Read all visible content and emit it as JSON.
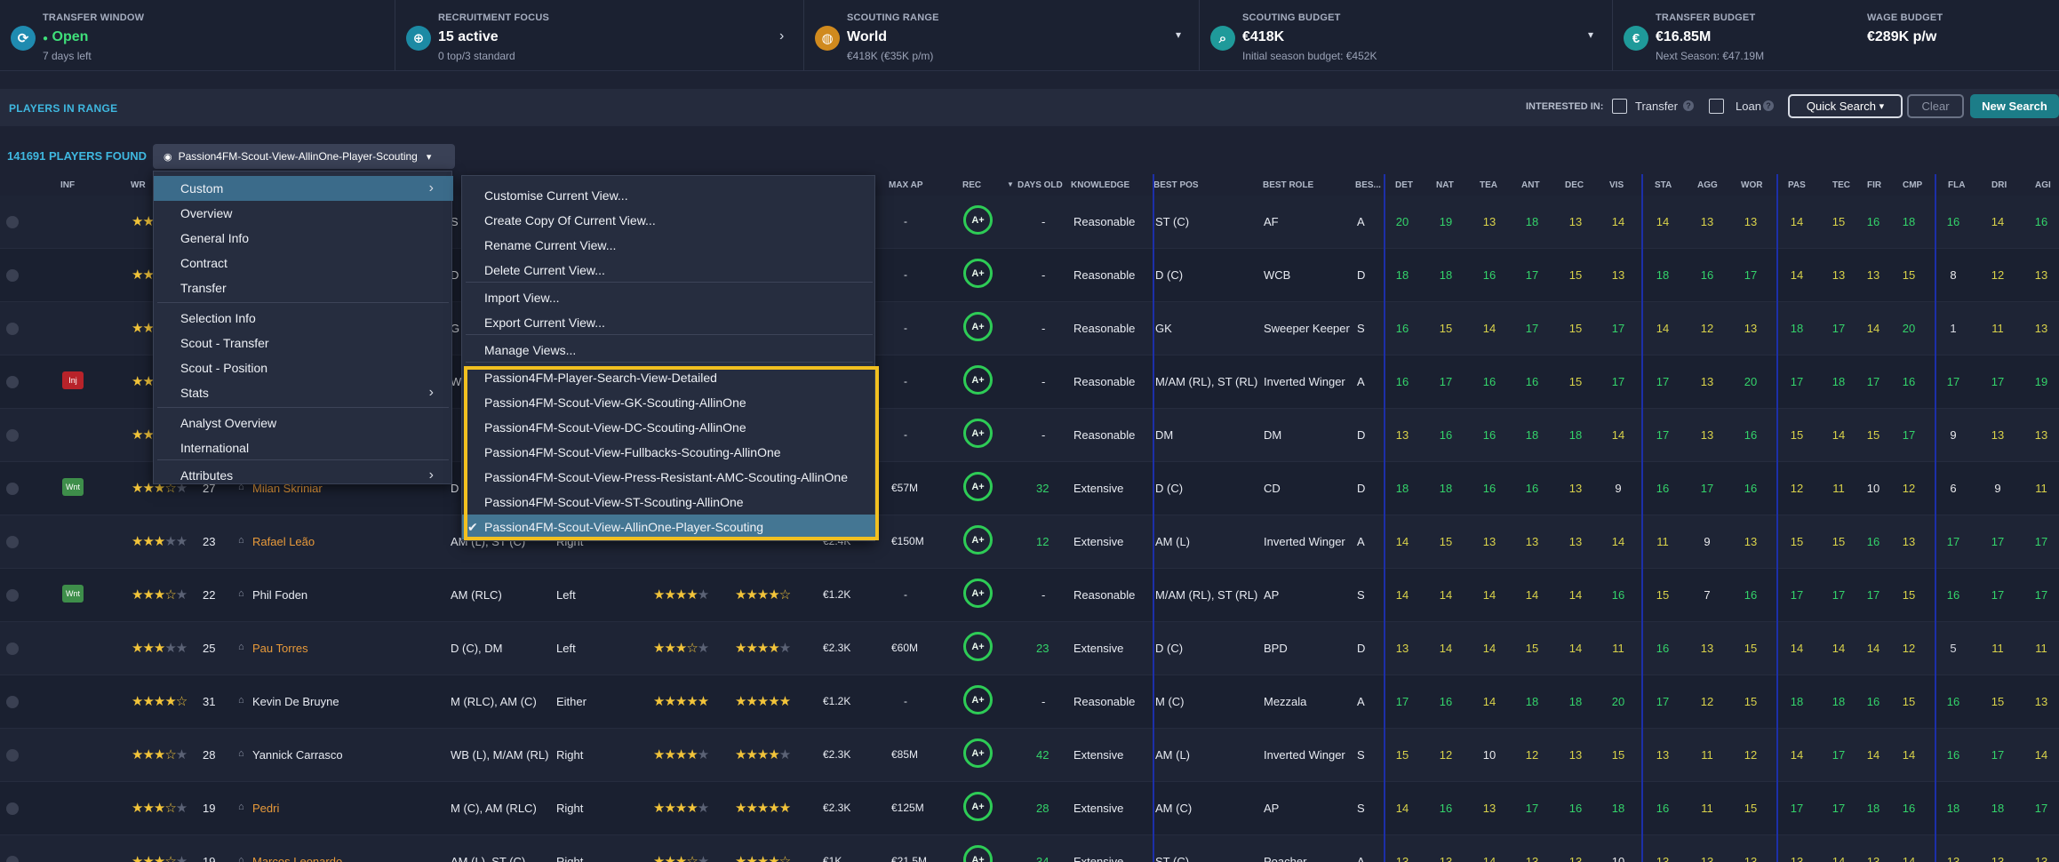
{
  "top": {
    "transfer_window": {
      "label": "TRANSFER WINDOW",
      "value": "Open",
      "sub": "7 days left",
      "icon": "refresh-icon"
    },
    "recruitment": {
      "label": "RECRUITMENT FOCUS",
      "value": "15 active",
      "sub": "0 top/3 standard",
      "icon": "target-icon"
    },
    "scouting_range": {
      "label": "SCOUTING RANGE",
      "value": "World",
      "sub": "€418K (€35K p/m)",
      "icon": "globe-icon"
    },
    "scouting_budget": {
      "label": "SCOUTING BUDGET",
      "value": "€418K",
      "sub": "Initial season budget: €452K",
      "icon": "search-icon"
    },
    "transfer_budget": {
      "label": "TRANSFER BUDGET",
      "value": "€16.85M",
      "sub": "Next Season: €47.19M",
      "icon": "money-icon"
    },
    "wage_budget": {
      "label": "WAGE BUDGET",
      "value": "€289K p/w"
    }
  },
  "bar": {
    "title": "PLAYERS IN RANGE",
    "interested_in": "INTERESTED IN:",
    "transfer": "Transfer",
    "loan": "Loan",
    "quick_search": "Quick Search",
    "clear": "Clear",
    "new_search": "New Search",
    "found": "141691 PLAYERS FOUND",
    "view_name": "Passion4FM-Scout-View-AllinOne-Player-Scouting"
  },
  "headers": {
    "inf": "INF",
    "wr": "WR",
    "max_ap": "MAX AP",
    "rec": "REC",
    "days_old": "DAYS OLD",
    "knowledge": "KNOWLEDGE",
    "best_pos": "BEST POS",
    "best_role": "BEST ROLE",
    "bes": "BES...",
    "det": "DET",
    "nat": "NAT",
    "tea": "TEA",
    "ant": "ANT",
    "dec": "DEC",
    "vis": "VIS",
    "sta": "STA",
    "agg": "AGG",
    "wor": "WOR",
    "pas": "PAS",
    "tec": "TEC",
    "fir": "FIR",
    "cmp": "CMP",
    "fla": "FLA",
    "dri": "DRI",
    "agi": "AGI"
  },
  "rows": [
    {
      "tag": "",
      "stars": 4,
      "age": "",
      "name": "",
      "pos": "S",
      "foot": "",
      "ca": 0,
      "pa": 0,
      "wage": "",
      "ap": "-",
      "rec": "A+",
      "days": "-",
      "know": "Reasonable",
      "bpos": "ST (C)",
      "brole": "AF",
      "duty": "A",
      "a": [
        "20",
        "19",
        "13",
        "18",
        "13",
        "14",
        "14",
        "13",
        "13",
        "14",
        "15",
        "16",
        "18",
        "16",
        "14",
        "16"
      ]
    },
    {
      "tag": "",
      "stars": 4,
      "age": "",
      "name": "",
      "pos": "D",
      "foot": "",
      "ca": 0,
      "pa": 0,
      "wage": "",
      "ap": "-",
      "rec": "A+",
      "days": "-",
      "know": "Reasonable",
      "bpos": "D (C)",
      "brole": "WCB",
      "duty": "D",
      "a": [
        "18",
        "18",
        "16",
        "17",
        "15",
        "13",
        "18",
        "16",
        "17",
        "14",
        "13",
        "13",
        "15",
        "8",
        "12",
        "13"
      ]
    },
    {
      "tag": "",
      "stars": 4,
      "age": "",
      "name": "",
      "pos": "G",
      "foot": "",
      "ca": 0,
      "pa": 0,
      "wage": "",
      "ap": "-",
      "rec": "A+",
      "days": "-",
      "know": "Reasonable",
      "bpos": "GK",
      "brole": "Sweeper Keeper",
      "duty": "S",
      "a": [
        "16",
        "15",
        "14",
        "17",
        "15",
        "17",
        "14",
        "12",
        "13",
        "18",
        "17",
        "14",
        "20",
        "1",
        "11",
        "13"
      ]
    },
    {
      "tag": "Inj",
      "stars": 4,
      "age": "",
      "name": "",
      "pos": "W",
      "foot": "",
      "ca": 0,
      "pa": 0,
      "wage": "",
      "ap": "-",
      "rec": "A+",
      "days": "-",
      "know": "Reasonable",
      "bpos": "M/AM (RL), ST (RL)",
      "brole": "Inverted Winger",
      "duty": "A",
      "a": [
        "16",
        "17",
        "16",
        "16",
        "15",
        "17",
        "17",
        "13",
        "20",
        "17",
        "18",
        "17",
        "16",
        "17",
        "17",
        "19"
      ]
    },
    {
      "tag": "",
      "stars": 4,
      "age": "",
      "name": "",
      "pos": "",
      "foot": "",
      "ca": 0,
      "pa": 0,
      "wage": "",
      "ap": "-",
      "rec": "A+",
      "days": "-",
      "know": "Reasonable",
      "bpos": "DM",
      "brole": "DM",
      "duty": "D",
      "a": [
        "13",
        "16",
        "16",
        "18",
        "18",
        "14",
        "17",
        "13",
        "16",
        "15",
        "14",
        "15",
        "17",
        "9",
        "13",
        "13"
      ]
    },
    {
      "tag": "Wnt",
      "stars": 3.5,
      "age": "27",
      "name": "Milan Škriniar",
      "pos": "D",
      "foot": "",
      "ca": 0,
      "pa": 0,
      "wage": "",
      "ap": "€57M",
      "rec": "A+",
      "days": "32",
      "know": "Extensive",
      "bpos": "D (C)",
      "brole": "CD",
      "duty": "D",
      "a": [
        "18",
        "18",
        "16",
        "16",
        "13",
        "9",
        "16",
        "17",
        "16",
        "12",
        "11",
        "10",
        "12",
        "6",
        "9",
        "11"
      ]
    },
    {
      "tag": "",
      "stars": 3,
      "age": "23",
      "name": "Rafael Leão",
      "pos": "AM (L), ST (C)",
      "foot": "Right",
      "ca": 0,
      "pa": 0,
      "wage": "€2.4K",
      "ap": "€150M",
      "rec": "A+",
      "days": "12",
      "know": "Extensive",
      "bpos": "AM (L)",
      "brole": "Inverted Winger",
      "duty": "A",
      "a": [
        "14",
        "15",
        "13",
        "13",
        "13",
        "14",
        "11",
        "9",
        "13",
        "15",
        "15",
        "16",
        "13",
        "17",
        "17",
        "17"
      ]
    },
    {
      "tag": "Wnt",
      "stars": 3.5,
      "age": "22",
      "name": "Phil Foden",
      "pos": "AM (RLC)",
      "foot": "Left",
      "ca": 4,
      "pa": 4.5,
      "wage": "€1.2K",
      "ap": "-",
      "rec": "A+",
      "days": "-",
      "know": "Reasonable",
      "bpos": "M/AM (RL), ST (RL)",
      "brole": "AP",
      "duty": "S",
      "a": [
        "14",
        "14",
        "14",
        "14",
        "14",
        "16",
        "15",
        "7",
        "16",
        "17",
        "17",
        "17",
        "15",
        "16",
        "17",
        "17"
      ]
    },
    {
      "tag": "",
      "stars": 3,
      "age": "25",
      "name": "Pau Torres",
      "pos": "D (C), DM",
      "foot": "Left",
      "ca": 3.5,
      "pa": 4,
      "wage": "€2.3K",
      "ap": "€60M",
      "rec": "A+",
      "days": "23",
      "know": "Extensive",
      "bpos": "D (C)",
      "brole": "BPD",
      "duty": "D",
      "a": [
        "13",
        "14",
        "14",
        "15",
        "14",
        "11",
        "16",
        "13",
        "15",
        "14",
        "14",
        "14",
        "12",
        "5",
        "11",
        "11"
      ]
    },
    {
      "tag": "",
      "stars": 4.5,
      "age": "31",
      "name": "Kevin De Bruyne",
      "pos": "M (RLC), AM (C)",
      "foot": "Either",
      "ca": 5,
      "pa": 5,
      "wage": "€1.2K",
      "ap": "-",
      "rec": "A+",
      "days": "-",
      "know": "Reasonable",
      "bpos": "M (C)",
      "brole": "Mezzala",
      "duty": "A",
      "a": [
        "17",
        "16",
        "14",
        "18",
        "18",
        "20",
        "17",
        "12",
        "15",
        "18",
        "18",
        "16",
        "15",
        "16",
        "15",
        "13"
      ]
    },
    {
      "tag": "",
      "stars": 3.5,
      "age": "28",
      "name": "Yannick Carrasco",
      "pos": "WB (L), M/AM (RL)",
      "foot": "Right",
      "ca": 4,
      "pa": 4,
      "wage": "€2.3K",
      "ap": "€85M",
      "rec": "A+",
      "days": "42",
      "know": "Extensive",
      "bpos": "AM (L)",
      "brole": "Inverted Winger",
      "duty": "S",
      "a": [
        "15",
        "12",
        "10",
        "12",
        "13",
        "15",
        "13",
        "11",
        "12",
        "14",
        "17",
        "14",
        "14",
        "16",
        "17",
        "14"
      ]
    },
    {
      "tag": "",
      "stars": 3.5,
      "age": "19",
      "name": "Pedri",
      "pos": "M (C), AM (RLC)",
      "foot": "Right",
      "ca": 4,
      "pa": 5,
      "wage": "€2.3K",
      "ap": "€125M",
      "rec": "A+",
      "days": "28",
      "know": "Extensive",
      "bpos": "AM (C)",
      "brole": "AP",
      "duty": "S",
      "a": [
        "14",
        "16",
        "13",
        "17",
        "16",
        "18",
        "16",
        "11",
        "15",
        "17",
        "17",
        "18",
        "16",
        "18",
        "18",
        "17"
      ]
    },
    {
      "tag": "",
      "stars": 3.5,
      "age": "19",
      "name": "Marcos Leonardo",
      "pos": "AM (L), ST (C)",
      "foot": "Right",
      "ca": 3.5,
      "pa": 4.5,
      "wage": "€1K",
      "ap": "€21.5M",
      "rec": "A+",
      "days": "34",
      "know": "Extensive",
      "bpos": "ST (C)",
      "brole": "Poacher",
      "duty": "A",
      "a": [
        "13",
        "13",
        "14",
        "13",
        "13",
        "10",
        "13",
        "13",
        "13",
        "13",
        "14",
        "13",
        "14",
        "13",
        "13",
        "13"
      ]
    }
  ],
  "menu_left": {
    "items": [
      "Custom",
      "Overview",
      "General Info",
      "Contract",
      "Transfer",
      "Selection Info",
      "Scout - Transfer",
      "Scout - Position",
      "Stats",
      "Analyst Overview",
      "International",
      "Attributes"
    ]
  },
  "menu_right": {
    "items": [
      "Customise Current View...",
      "Create Copy Of Current View...",
      "Rename Current View...",
      "Delete Current View...",
      "Import View...",
      "Export Current View...",
      "Manage Views...",
      "Passion4FM-Player-Search-View-Detailed",
      "Passion4FM-Scout-View-GK-Scouting-AllinOne",
      "Passion4FM-Scout-View-DC-Scouting-AllinOne",
      "Passion4FM-Scout-View-Fullbacks-Scouting-AllinOne",
      "Passion4FM-Scout-View-Press-Resistant-AMC-Scouting-AllinOne",
      "Passion4FM-Scout-View-ST-Scouting-AllinOne",
      "Passion4FM-Scout-View-AllinOne-Player-Scouting"
    ],
    "checked": "✔"
  },
  "colors": {
    "accent": "#3fb8e0",
    "green": "#2ecc56",
    "highlight": "#3b6b8a",
    "yellow_box": "#f2c020",
    "divider": "#1c2fa8"
  }
}
